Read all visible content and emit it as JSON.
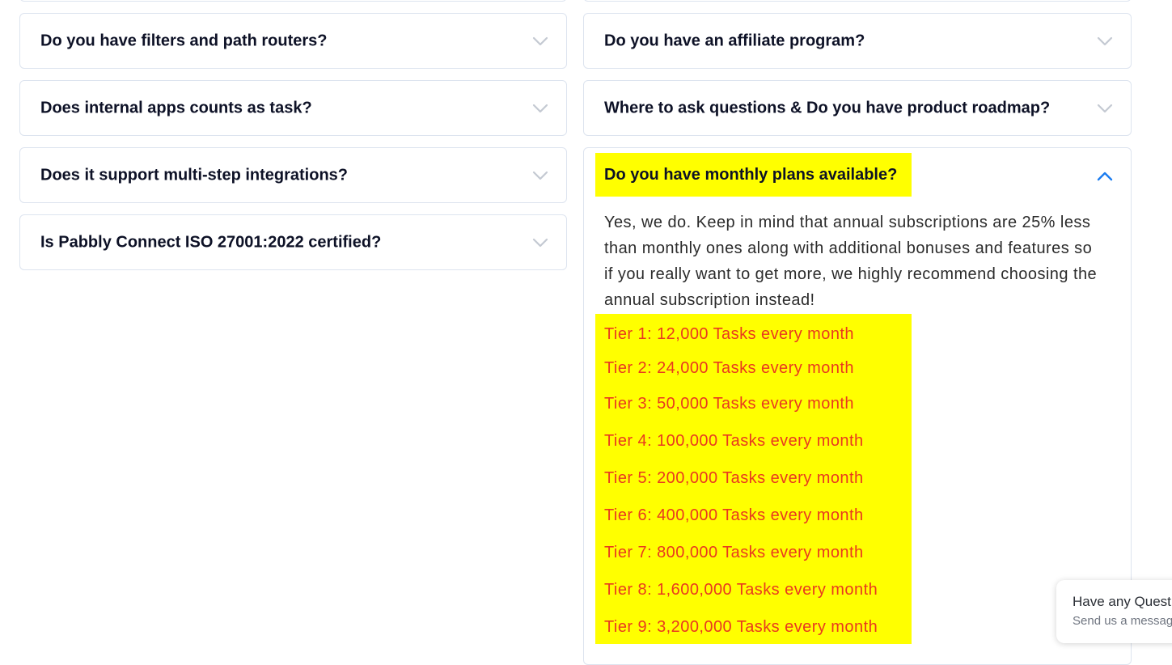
{
  "faq": {
    "left": [
      {
        "question": "Do you have filters and path routers?"
      },
      {
        "question": "Does internal apps counts as task?"
      },
      {
        "question": "Does it support multi-step integrations?"
      },
      {
        "question": "Is Pabbly Connect ISO 27001:2022 certified?"
      }
    ],
    "right": [
      {
        "question": "Do you have an affiliate program?"
      },
      {
        "question": "Where to ask questions & Do you have product roadmap?"
      }
    ],
    "open_item": {
      "question": "Do you have monthly plans available?",
      "answer": "Yes, we do. Keep in mind that annual subscriptions are 25% less than monthly ones along with additional bonuses and features so if you really want to get more, we highly recommend choosing the annual subscription instead!",
      "tiers": [
        "Tier 1: 12,000 Tasks every month",
        "Tier 2: 24,000 Tasks every month",
        "Tier 3: 50,000 Tasks every month",
        "Tier 4: 100,000 Tasks every month",
        "Tier 5: 200,000 Tasks every month",
        "Tier 6: 400,000 Tasks every month",
        "Tier 7: 800,000 Tasks every month",
        "Tier 8: 1,600,000 Tasks every month",
        "Tier 9: 3,200,000 Tasks every month"
      ]
    }
  },
  "chat_widget": {
    "title": "Have any Questions?",
    "subtitle": "Send us a message"
  },
  "colors": {
    "highlight": "#ffff00",
    "tier_text": "#e9391f",
    "chevron_closed": "#c4c9d2",
    "chevron_open": "#1a7cf0",
    "card_border": "#dde4ef"
  },
  "icons": {
    "collapsed": "chevron-down-icon",
    "expanded": "chevron-up-icon"
  }
}
